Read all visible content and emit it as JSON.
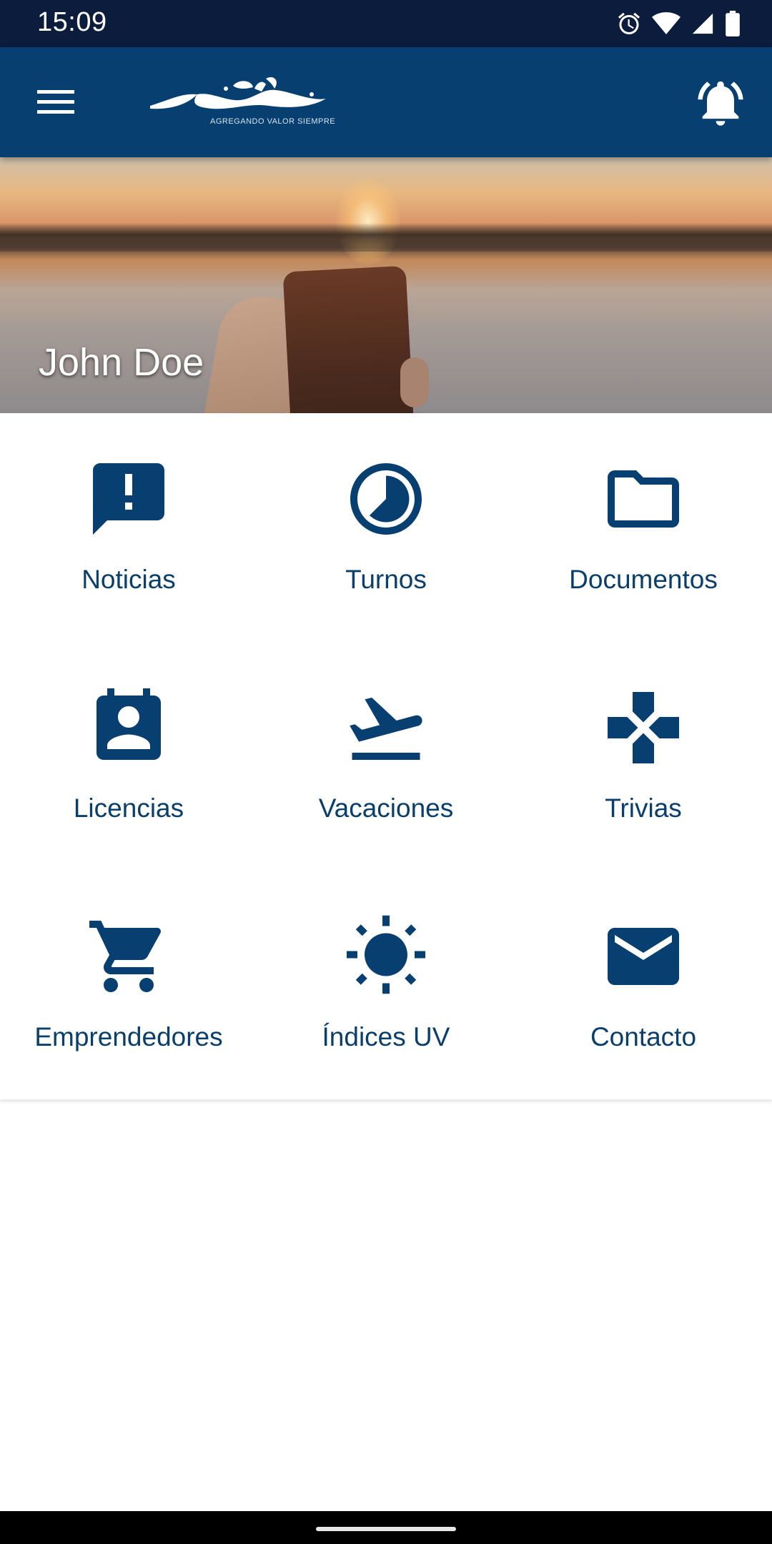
{
  "status_bar": {
    "time": "15:09",
    "icons": [
      "alarm-icon",
      "wifi-icon",
      "signal-icon",
      "battery-icon"
    ]
  },
  "app_bar": {
    "menu_icon": "hamburger-menu-icon",
    "logo_tagline": "AGREGANDO VALOR SIEMPRE",
    "notifications_icon": "bell-ringing-icon",
    "background_color": "#063f70"
  },
  "hero": {
    "user_name": "John Doe"
  },
  "menu": {
    "accent_color": "#063f70",
    "items": [
      {
        "label": "Noticias",
        "icon": "announcement-icon"
      },
      {
        "label": "Turnos",
        "icon": "clock-icon"
      },
      {
        "label": "Documentos",
        "icon": "folder-icon"
      },
      {
        "label": "Licencias",
        "icon": "contact-calendar-icon"
      },
      {
        "label": "Vacaciones",
        "icon": "flight-takeoff-icon"
      },
      {
        "label": "Trivias",
        "icon": "gamepad-icon"
      },
      {
        "label": "Emprendedores",
        "icon": "shopping-cart-icon"
      },
      {
        "label": "Índices UV",
        "icon": "sun-icon"
      },
      {
        "label": "Contacto",
        "icon": "mail-icon"
      }
    ]
  }
}
